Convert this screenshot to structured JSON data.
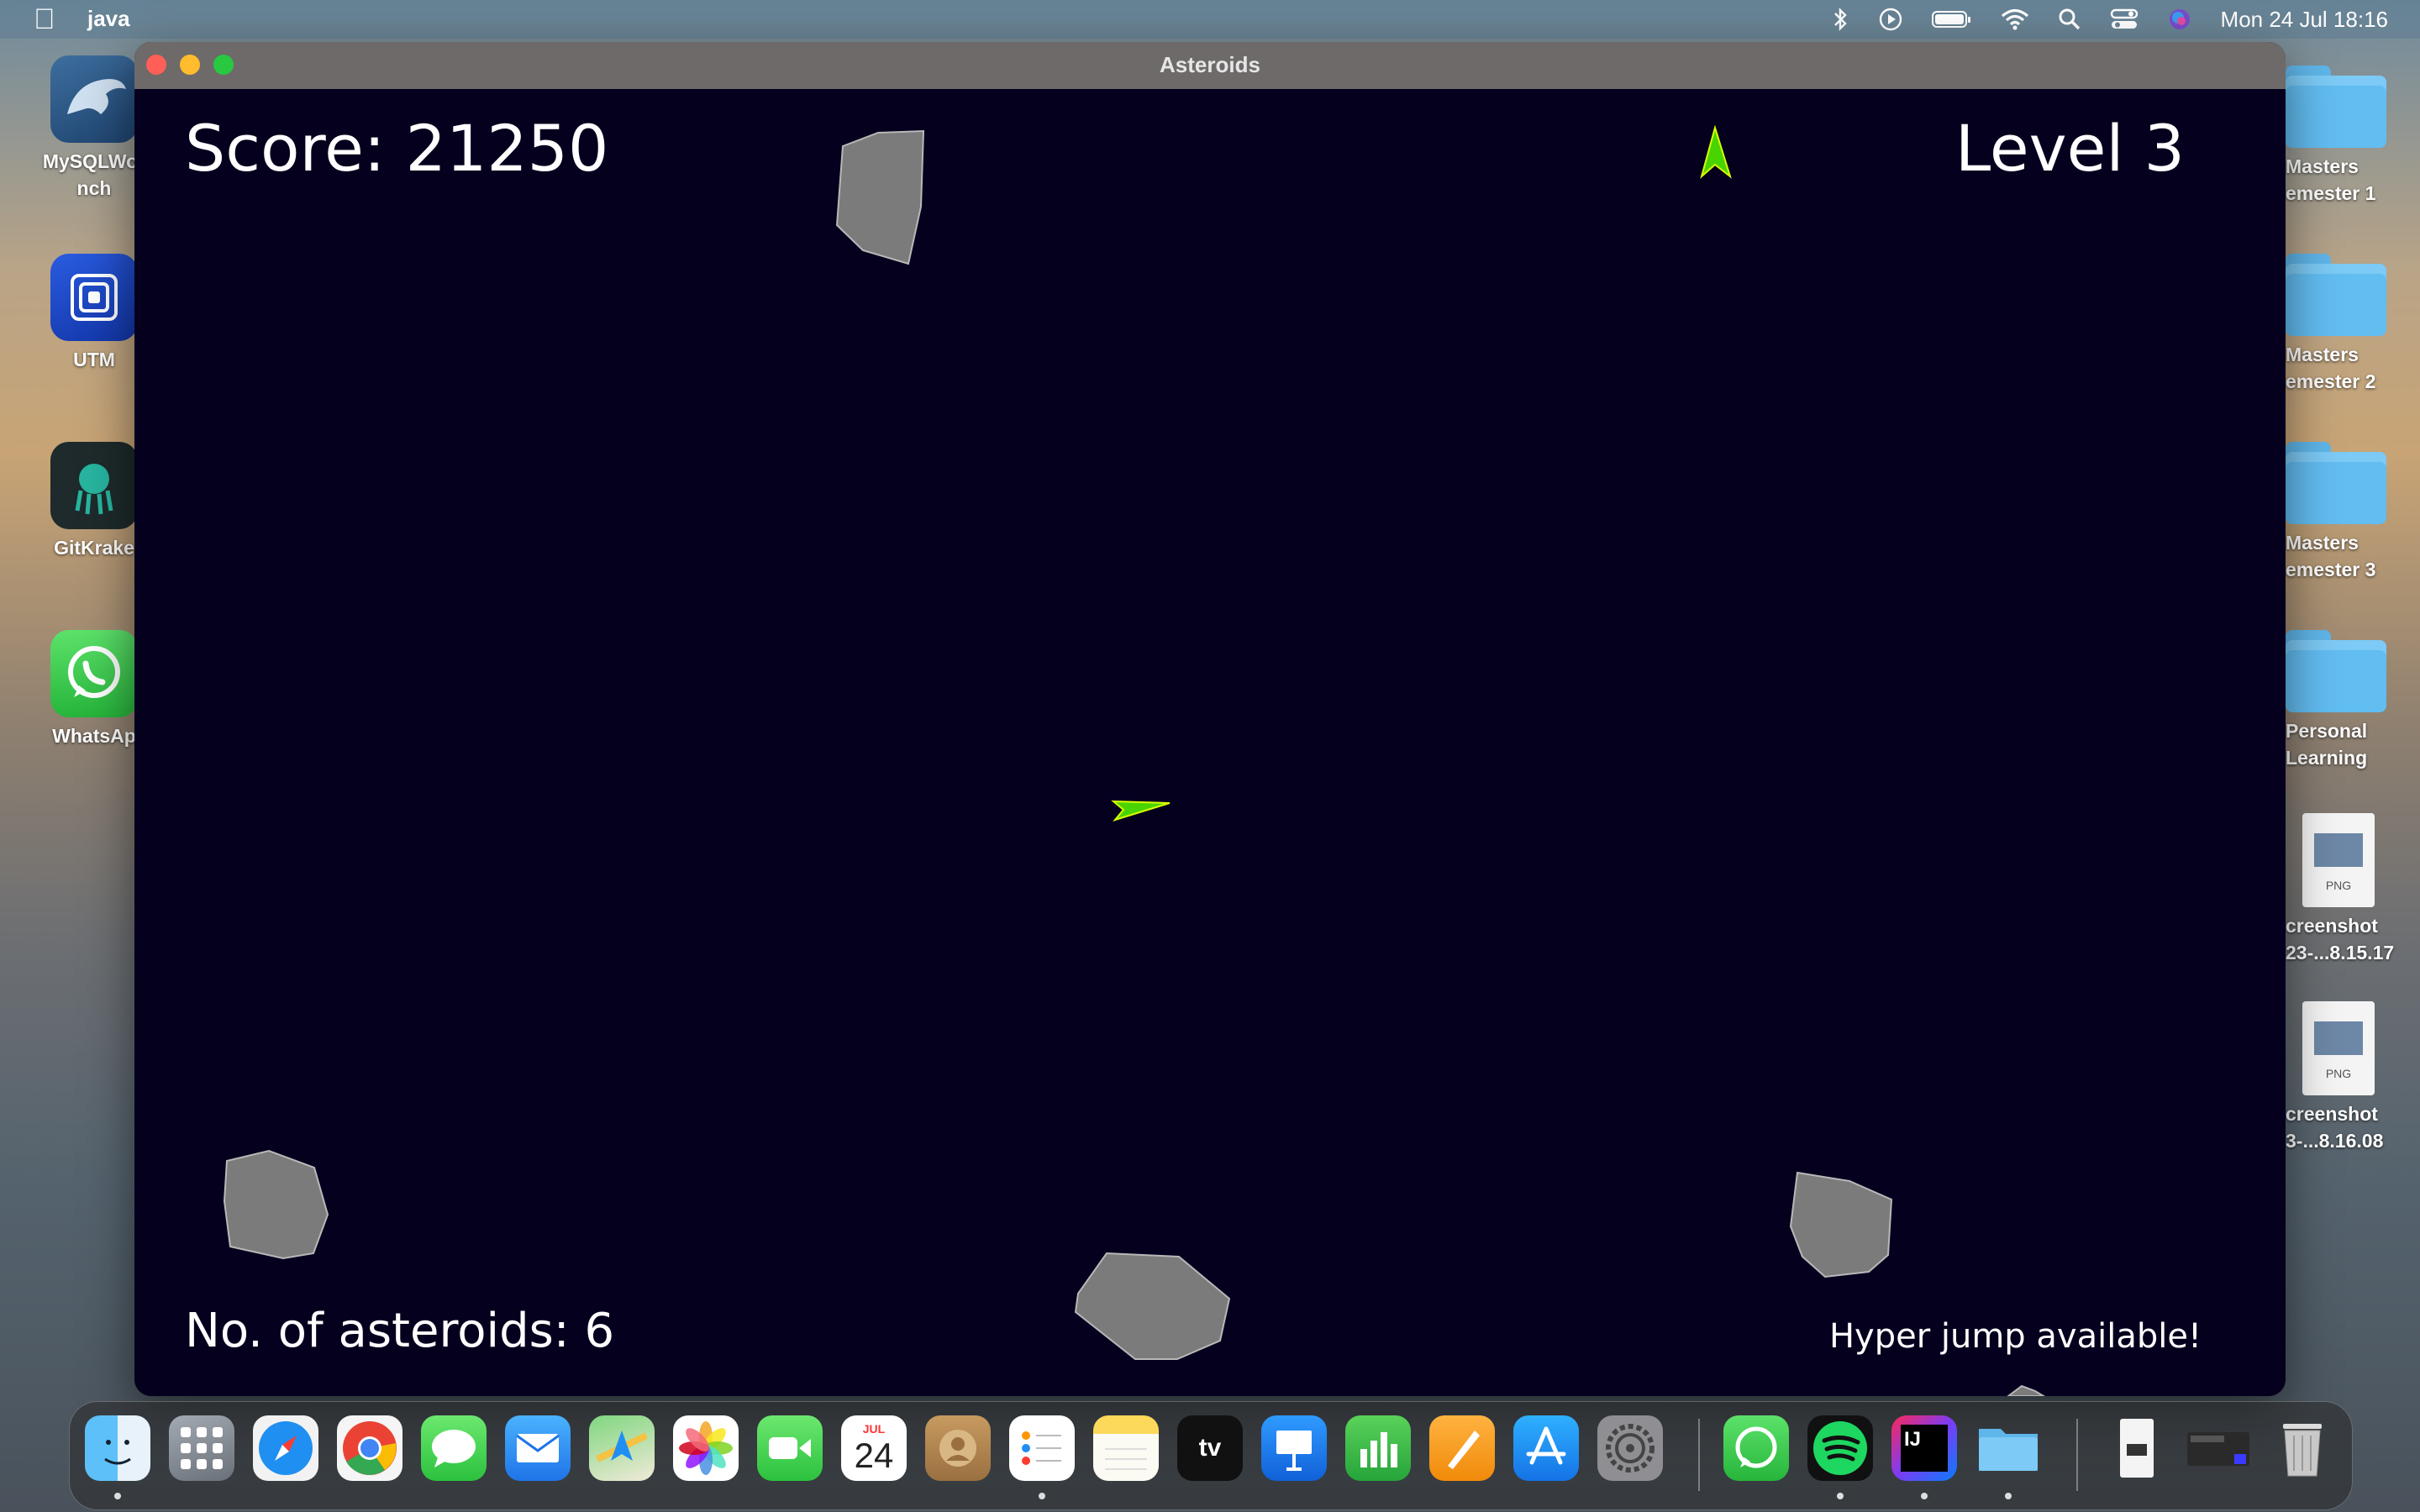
{
  "menubar": {
    "apple_icon": "apple-logo",
    "app_name": "java",
    "clock": "Mon 24 Jul  18:16"
  },
  "window": {
    "title": "Asteroids"
  },
  "game": {
    "score_text": "Score: 21250",
    "level_text": "Level 3",
    "asteroid_count_text": "No. of asteroids: 6",
    "hyperjump_text": "Hyper jump available!",
    "background_color": "#04001e",
    "ship_color": "#49d400",
    "asteroid_color": "#7b7b7b"
  },
  "desktop_left": [
    {
      "label": "MySQLWorkbench",
      "line1": "MySQLWor",
      "line2": "nch",
      "icon": "dolphin-icon"
    },
    {
      "label": "UTM",
      "line1": "UTM",
      "line2": "",
      "icon": "utm-icon"
    },
    {
      "label": "GitKraken",
      "line1": "GitKrake",
      "line2": "",
      "icon": "kraken-icon"
    },
    {
      "label": "WhatsApp",
      "line1": "WhatsAp",
      "line2": "",
      "icon": "whatsapp-icon"
    }
  ],
  "desktop_right": [
    {
      "line1": "Masters",
      "line2": "emester 1",
      "icon": "folder-icon"
    },
    {
      "line1": "Masters",
      "line2": "emester 2",
      "icon": "folder-icon"
    },
    {
      "line1": "Masters",
      "line2": "emester 3",
      "icon": "folder-icon"
    },
    {
      "line1": "Personal",
      "line2": "Learning",
      "icon": "folder-icon"
    },
    {
      "line1": "creenshot",
      "line2": "23-...8.15.17",
      "icon": "png-file-icon",
      "badge": "PNG"
    },
    {
      "line1": "creenshot",
      "line2": "3-...8.16.08",
      "icon": "png-file-icon",
      "badge": "PNG"
    }
  ],
  "dock": {
    "calendar_month": "JUL",
    "calendar_day": "24",
    "tv_label": "tv",
    "intellij_label": "IJ"
  }
}
